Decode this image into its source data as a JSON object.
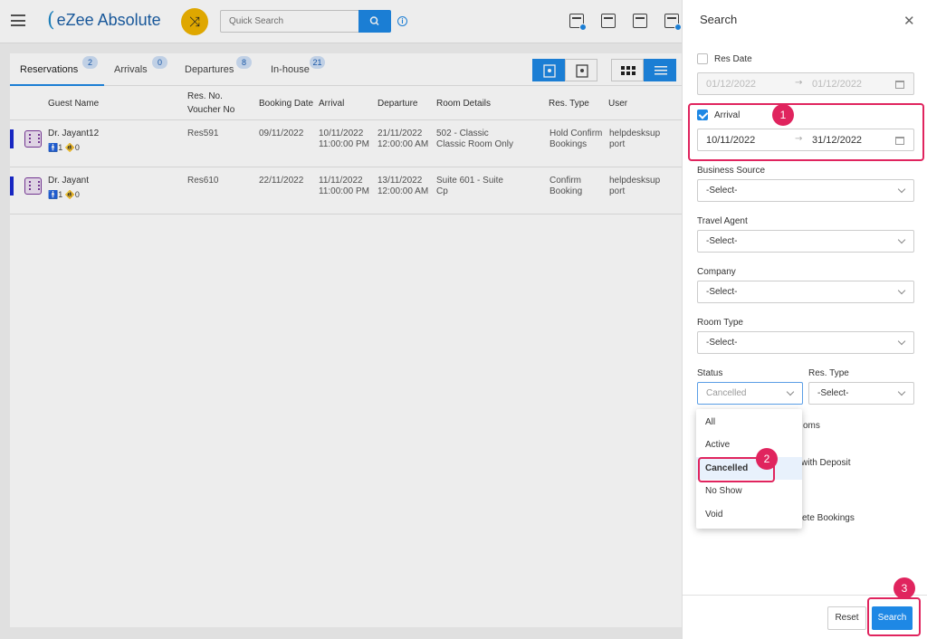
{
  "header": {
    "logo_text": "eZee Absolute",
    "logo_mark": "(",
    "quick_search_placeholder": "Quick Search",
    "shuffle_icon": "⤨",
    "info_icon": "i"
  },
  "tabs": [
    {
      "label": "Reservations",
      "count": "2"
    },
    {
      "label": "Arrivals",
      "count": "0"
    },
    {
      "label": "Departures",
      "count": "8"
    },
    {
      "label": "In-house",
      "count": "21"
    }
  ],
  "table": {
    "columns": {
      "guest_name": "Guest Name",
      "res_no_1": "Res. No.",
      "res_no_2": "Voucher No",
      "booking_date": "Booking Date",
      "arrival": "Arrival",
      "departure": "Departure",
      "room_details": "Room Details",
      "res_type": "Res. Type",
      "user": "User"
    },
    "rows": [
      {
        "guest": "Dr. Jayant12",
        "pax": "🚹1 🚸0",
        "res_no": "Res591",
        "booking_date": "09/11/2022",
        "arrival_date": "10/11/2022",
        "arrival_time": "11:00:00 PM",
        "departure_date": "21/11/2022",
        "departure_time": "12:00:00 AM",
        "room_1": "502 - Classic",
        "room_2": "Classic Room Only",
        "res_type_1": "Hold Confirm",
        "res_type_2": "Bookings",
        "user_1": "helpdesksup",
        "user_2": "port"
      },
      {
        "guest": "Dr. Jayant",
        "pax": "🚹1 🚸0",
        "res_no": "Res610",
        "booking_date": "22/11/2022",
        "arrival_date": "11/11/2022",
        "arrival_time": "11:00:00 PM",
        "departure_date": "13/11/2022",
        "departure_time": "12:00:00 AM",
        "room_1": "Suite 601 - Suite",
        "room_2": "Cp",
        "res_type_1": "Confirm",
        "res_type_2": "Booking",
        "user_1": "helpdesksup",
        "user_2": "port"
      }
    ]
  },
  "panel": {
    "title": "Search",
    "close": "✕",
    "res_date_label": "Res Date",
    "res_date_from": "01/12/2022",
    "res_date_to": "01/12/2022",
    "arrival_label": "Arrival",
    "arrival_from": "10/11/2022",
    "arrival_to": "31/12/2022",
    "range_arrow": "→",
    "business_source_label": "Business Source",
    "business_source_value": "-Select-",
    "travel_agent_label": "Travel Agent",
    "travel_agent_value": "-Select-",
    "company_label": "Company",
    "company_value": "-Select-",
    "room_type_label": "Room Type",
    "room_type_value": "-Select-",
    "status_label": "Status",
    "status_value": "Cancelled",
    "res_type_label": "Res. Type",
    "res_type_value": "-Select-",
    "status_options": [
      "All",
      "Active",
      "Cancelled",
      "No Show",
      "Void"
    ],
    "behind_1": "oms",
    "behind_2": "with Deposit",
    "behind_3": "ete Bookings",
    "reset_label": "Reset",
    "search_label": "Search"
  },
  "annotations": {
    "step_1": "1",
    "step_2": "2",
    "step_3": "3",
    "highlight_color": "#e0245e"
  }
}
